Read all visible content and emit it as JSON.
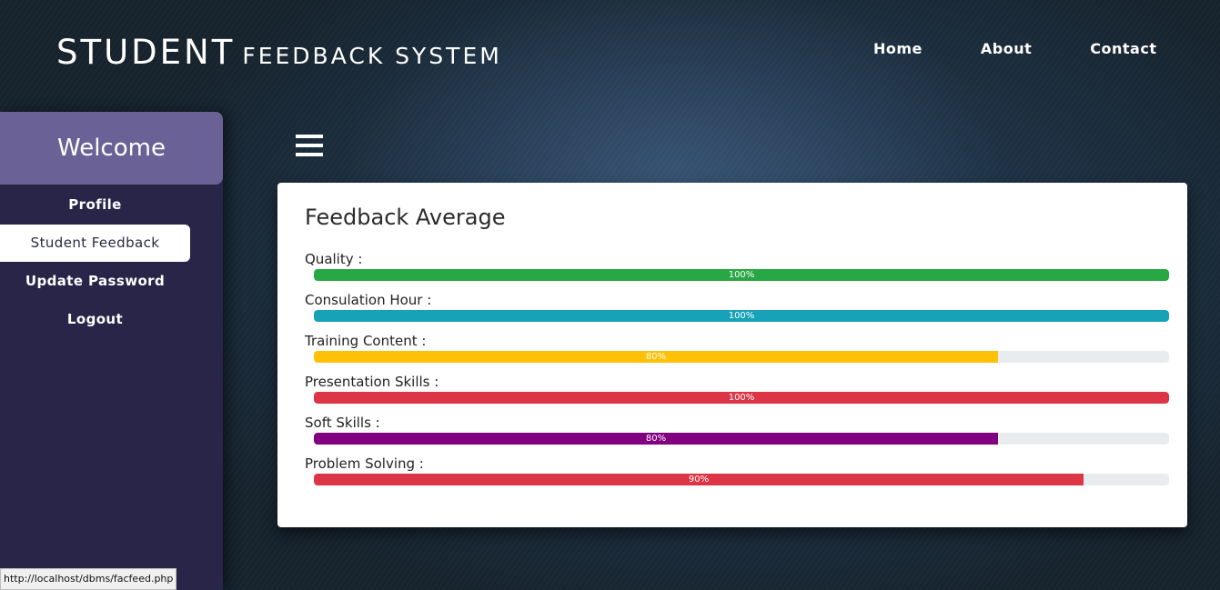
{
  "header": {
    "title_big": "STUDENT",
    "title_small": "FEEDBACK SYSTEM",
    "nav": [
      "Home",
      "About",
      "Contact"
    ]
  },
  "sidebar": {
    "welcome": "Welcome",
    "items": [
      {
        "label": "Profile",
        "active": false
      },
      {
        "label": "Student Feedback",
        "active": true
      },
      {
        "label": "Update Password",
        "active": false
      },
      {
        "label": "Logout",
        "active": false
      }
    ]
  },
  "menu_icon": "hamburger-icon",
  "card": {
    "title": "Feedback Average",
    "bars": [
      {
        "label": "Quality :",
        "percent": 100,
        "text": "100%",
        "color": "#28a745"
      },
      {
        "label": "Consulation Hour :",
        "percent": 100,
        "text": "100%",
        "color": "#17a2b8"
      },
      {
        "label": "Training Content :",
        "percent": 80,
        "text": "80%",
        "color": "#ffc107"
      },
      {
        "label": "Presentation Skills :",
        "percent": 100,
        "text": "100%",
        "color": "#dc3545"
      },
      {
        "label": "Soft Skills :",
        "percent": 80,
        "text": "80%",
        "color": "#800080"
      },
      {
        "label": "Problem Solving :",
        "percent": 90,
        "text": "90%",
        "color": "#dc3545"
      }
    ]
  },
  "status_bar": {
    "url": "http://localhost/dbms/facfeed.php"
  }
}
